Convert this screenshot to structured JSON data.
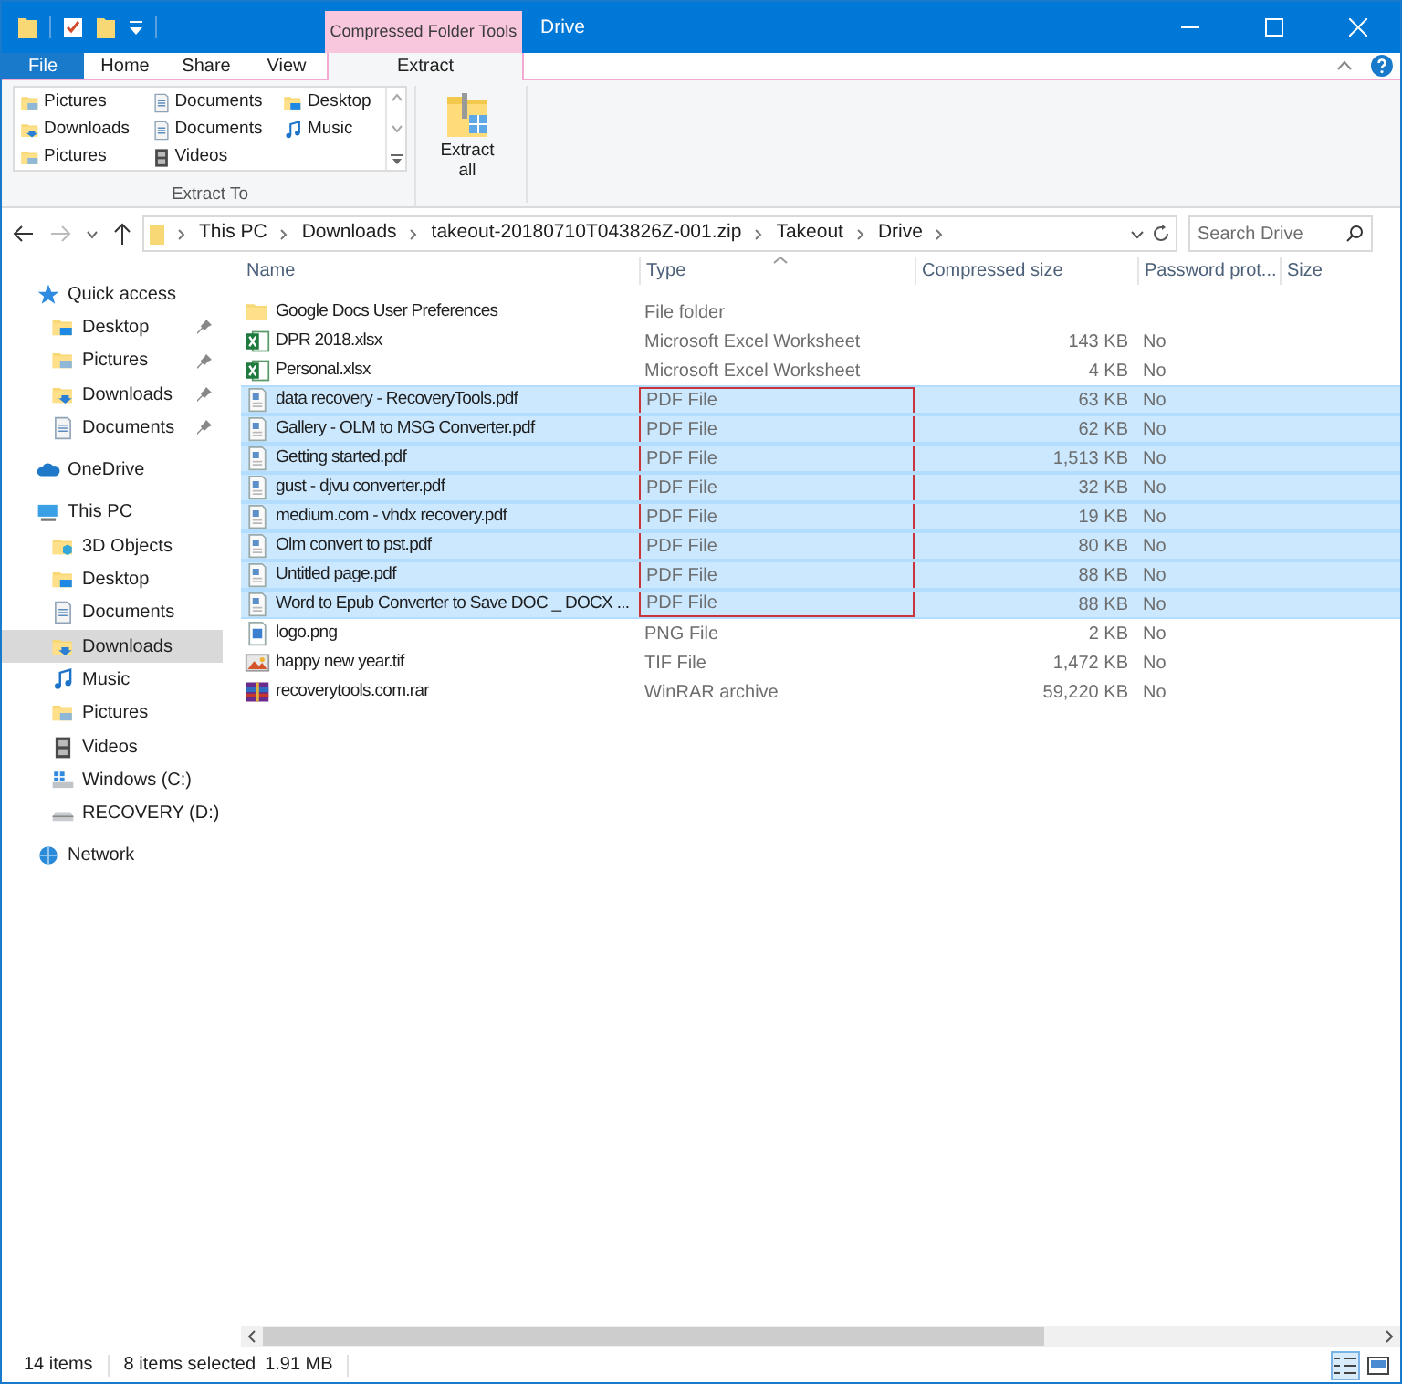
{
  "window": {
    "title": "Drive",
    "context_tab": "Compressed Folder Tools"
  },
  "ribbon_tabs": [
    {
      "label": "File",
      "kind": "file",
      "selected": false
    },
    {
      "label": "Home",
      "kind": "tab",
      "selected": false
    },
    {
      "label": "Share",
      "kind": "tab",
      "selected": false
    },
    {
      "label": "View",
      "kind": "tab",
      "selected": false
    },
    {
      "label": "Extract",
      "kind": "tab",
      "selected": true
    }
  ],
  "extract_to": {
    "items": [
      {
        "label": "Pictures",
        "kind": "pictures"
      },
      {
        "label": "Documents",
        "kind": "documents"
      },
      {
        "label": "Desktop",
        "kind": "desktop"
      },
      {
        "label": "Downloads",
        "kind": "downloads"
      },
      {
        "label": "Documents",
        "kind": "documents"
      },
      {
        "label": "Music",
        "kind": "music"
      },
      {
        "label": "Pictures",
        "kind": "pictures"
      },
      {
        "label": "Videos",
        "kind": "videos"
      }
    ],
    "group_label": "Extract To"
  },
  "extract_all": {
    "label": "Extract\nall"
  },
  "address": {
    "crumbs": [
      "This PC",
      "Downloads",
      "takeout-20180710T043826Z-001.zip",
      "Takeout",
      "Drive"
    ]
  },
  "search": {
    "placeholder": "Search Drive"
  },
  "nav": [
    {
      "label": "Quick access",
      "kind": "star",
      "selected": false,
      "children": [
        {
          "label": "Desktop",
          "kind": "desktop",
          "pinned": true,
          "selected": false
        },
        {
          "label": "Pictures",
          "kind": "pictures",
          "pinned": true,
          "selected": false
        },
        {
          "label": "Downloads",
          "kind": "downloads",
          "pinned": true,
          "selected": false
        },
        {
          "label": "Documents",
          "kind": "documents",
          "pinned": true,
          "selected": false
        }
      ]
    },
    {
      "label": "OneDrive",
      "kind": "cloud",
      "selected": false
    },
    {
      "label": "This PC",
      "kind": "pc",
      "selected": false,
      "children": [
        {
          "label": "3D Objects",
          "kind": "objects",
          "pinned": false,
          "selected": false
        },
        {
          "label": "Desktop",
          "kind": "desktop",
          "pinned": false,
          "selected": false
        },
        {
          "label": "Documents",
          "kind": "documents",
          "pinned": false,
          "selected": false
        },
        {
          "label": "Downloads",
          "kind": "downloads",
          "pinned": false,
          "selected": true
        },
        {
          "label": "Music",
          "kind": "music",
          "pinned": false,
          "selected": false
        },
        {
          "label": "Pictures",
          "kind": "pictures",
          "pinned": false,
          "selected": false
        },
        {
          "label": "Videos",
          "kind": "videos",
          "pinned": false,
          "selected": false
        },
        {
          "label": "Windows (C:)",
          "kind": "windrive",
          "pinned": false,
          "selected": false
        },
        {
          "label": "RECOVERY (D:)",
          "kind": "drive",
          "pinned": false,
          "selected": false
        }
      ]
    },
    {
      "label": "Network",
      "kind": "network",
      "selected": false
    }
  ],
  "table": {
    "columns": [
      "Name",
      "Type",
      "Compressed size",
      "Password prot...",
      "Size"
    ],
    "rows": [
      {
        "name": "Google Docs User Preferences",
        "type": "File folder",
        "compressed_size": "",
        "password": "",
        "kind": "folder",
        "selected": false,
        "highlighted": false
      },
      {
        "name": "DPR 2018.xlsx",
        "type": "Microsoft Excel Worksheet",
        "compressed_size": "143 KB",
        "password": "No",
        "kind": "excel",
        "selected": false,
        "highlighted": false
      },
      {
        "name": "Personal.xlsx",
        "type": "Microsoft Excel Worksheet",
        "compressed_size": "4 KB",
        "password": "No",
        "kind": "excel",
        "selected": false,
        "highlighted": false
      },
      {
        "name": "data recovery - RecoveryTools.pdf",
        "type": "PDF File",
        "compressed_size": "63 KB",
        "password": "No",
        "kind": "pdf",
        "selected": true,
        "highlighted": true
      },
      {
        "name": "Gallery - OLM to MSG Converter.pdf",
        "type": "PDF File",
        "compressed_size": "62 KB",
        "password": "No",
        "kind": "pdf",
        "selected": true,
        "highlighted": true
      },
      {
        "name": "Getting started.pdf",
        "type": "PDF File",
        "compressed_size": "1,513 KB",
        "password": "No",
        "kind": "pdf",
        "selected": true,
        "highlighted": true
      },
      {
        "name": "gust - djvu converter.pdf",
        "type": "PDF File",
        "compressed_size": "32 KB",
        "password": "No",
        "kind": "pdf",
        "selected": true,
        "highlighted": true
      },
      {
        "name": "medium.com - vhdx recovery.pdf",
        "type": "PDF File",
        "compressed_size": "19 KB",
        "password": "No",
        "kind": "pdf",
        "selected": true,
        "highlighted": true
      },
      {
        "name": "Olm convert to pst.pdf",
        "type": "PDF File",
        "compressed_size": "80 KB",
        "password": "No",
        "kind": "pdf",
        "selected": true,
        "highlighted": true
      },
      {
        "name": "Untitled page.pdf",
        "type": "PDF File",
        "compressed_size": "88 KB",
        "password": "No",
        "kind": "pdf",
        "selected": true,
        "highlighted": true
      },
      {
        "name": "Word to Epub Converter to Save DOC _ DOCX ...",
        "type": "PDF File",
        "compressed_size": "88 KB",
        "password": "No",
        "kind": "pdf",
        "selected": true,
        "highlighted": true
      },
      {
        "name": "logo.png",
        "type": "PNG File",
        "compressed_size": "2 KB",
        "password": "No",
        "kind": "png",
        "selected": false,
        "highlighted": false
      },
      {
        "name": "happy new year.tif",
        "type": "TIF File",
        "compressed_size": "1,472 KB",
        "password": "No",
        "kind": "tif",
        "selected": false,
        "highlighted": false
      },
      {
        "name": "recoverytools.com.rar",
        "type": "WinRAR archive",
        "compressed_size": "59,220 KB",
        "password": "No",
        "kind": "rar",
        "selected": false,
        "highlighted": false
      }
    ]
  },
  "status_bar": {
    "items": "14 items",
    "selected": "8 items selected",
    "size": "1.91 MB"
  }
}
